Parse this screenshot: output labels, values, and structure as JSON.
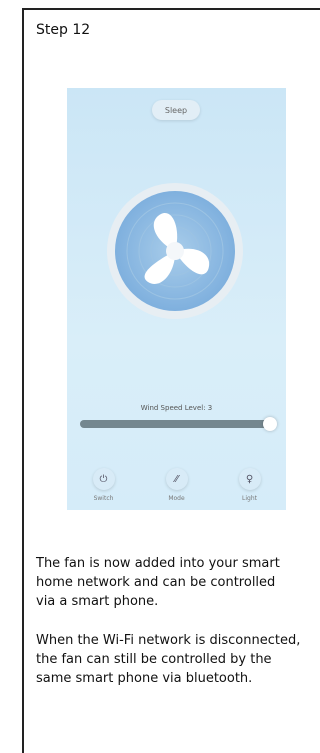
{
  "step_title": "Step 12",
  "app": {
    "mode_label": "Sleep",
    "wind_speed_label": "Wind Speed Level: 3",
    "wind_speed_fraction": 1.0,
    "controls": [
      {
        "label": "Switch",
        "icon": "power-icon"
      },
      {
        "label": "Mode",
        "icon": "mode-icon"
      },
      {
        "label": "Light",
        "icon": "bulb-icon"
      }
    ],
    "colors": {
      "background": "#d3ebf8",
      "fan_blades": "#ffffff",
      "slider_fill": "#74878f"
    }
  },
  "paragraphs": {
    "p1": [
      "The fan is now added into your smart",
      "home network and can be controlled",
      "via a smart phone."
    ],
    "p2": [
      "When the Wi-Fi network is disconnected,",
      "the fan can still be controlled by the",
      "same smart phone via bluetooth."
    ]
  }
}
